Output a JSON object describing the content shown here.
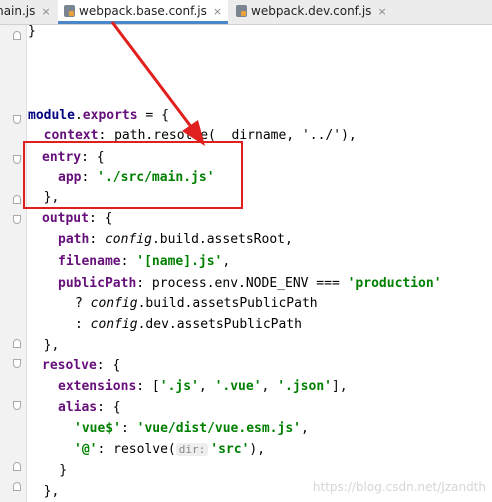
{
  "tabs": [
    {
      "label": "main.js"
    },
    {
      "label": "webpack.base.conf.js",
      "active": true
    },
    {
      "label": "webpack.dev.conf.js"
    }
  ],
  "close_glyph": "×",
  "code": {
    "l0": "}",
    "l1_a": "module",
    "l1_b": ".",
    "l1_c": "exports",
    "l1_d": " = {",
    "l2_a": "  ",
    "l2_b": "context",
    "l2_c": ": path.resolve(__dirname, '../'),",
    "l3_b": "entry",
    "l3_c": ": {",
    "l4_b": "app",
    "l4_c": ": ",
    "l4_d": "'./src/main.js'",
    "l5": "  },",
    "l6_b": "output",
    "l6_c": ": {",
    "l7_b": "path",
    "l7_c": ": ",
    "l7_d": "config",
    "l7_e": ".build.assetsRoot,",
    "l8_b": "filename",
    "l8_c": ": ",
    "l8_d": "'[name].js'",
    "l8_e": ",",
    "l9_b": "publicPath",
    "l9_c": ": process.env.NODE_ENV === ",
    "l9_d": "'production'",
    "l10_a": "      ? ",
    "l10_b": "config",
    "l10_c": ".build.assetsPublicPath",
    "l11_a": "      : ",
    "l11_b": "config",
    "l11_c": ".dev.assetsPublicPath",
    "l12": "  },",
    "l13_b": "resolve",
    "l13_c": ": {",
    "l14_b": "extensions",
    "l14_c": ": [",
    "l14_d": "'.js'",
    "l14_e": ", ",
    "l14_f": "'.vue'",
    "l14_g": ", ",
    "l14_h": "'.json'",
    "l14_i": "],",
    "l15_b": "alias",
    "l15_c": ": {",
    "l16_a": "'vue$'",
    "l16_b": ": ",
    "l16_c": "'vue/dist/vue.esm.js'",
    "l16_d": ",",
    "l17_a": "'@'",
    "l17_b": ": resolve(",
    "l17_hint": "dir:",
    "l17_c": "'src'",
    "l17_d": "),",
    "l18": "    }",
    "l19": "  },"
  },
  "watermark": "https://blog.csdn.net/Jzandth",
  "colors": {
    "annotation": "#e0201f",
    "keyword": "#000080",
    "property": "#660e7a",
    "string": "#008000"
  }
}
